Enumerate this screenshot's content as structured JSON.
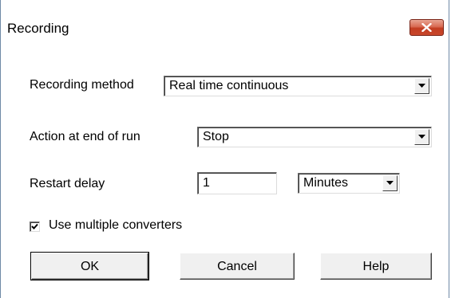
{
  "window": {
    "title": "Recording"
  },
  "form": {
    "recording_method": {
      "label": "Recording method",
      "value": "Real time continuous"
    },
    "action_end_of_run": {
      "label": "Action at end of run",
      "value": "Stop"
    },
    "restart_delay": {
      "label": "Restart delay",
      "value": "1",
      "unit": "Minutes"
    },
    "use_multiple_converters": {
      "label": "Use multiple converters",
      "checked": true
    }
  },
  "buttons": {
    "ok": "OK",
    "cancel": "Cancel",
    "help": "Help"
  },
  "icons": {
    "close": "close-icon",
    "dropdown": "chevron-down-icon",
    "check": "checkmark-icon"
  },
  "colors": {
    "close_button": "#c8472b",
    "face": "#f0f0f0"
  }
}
